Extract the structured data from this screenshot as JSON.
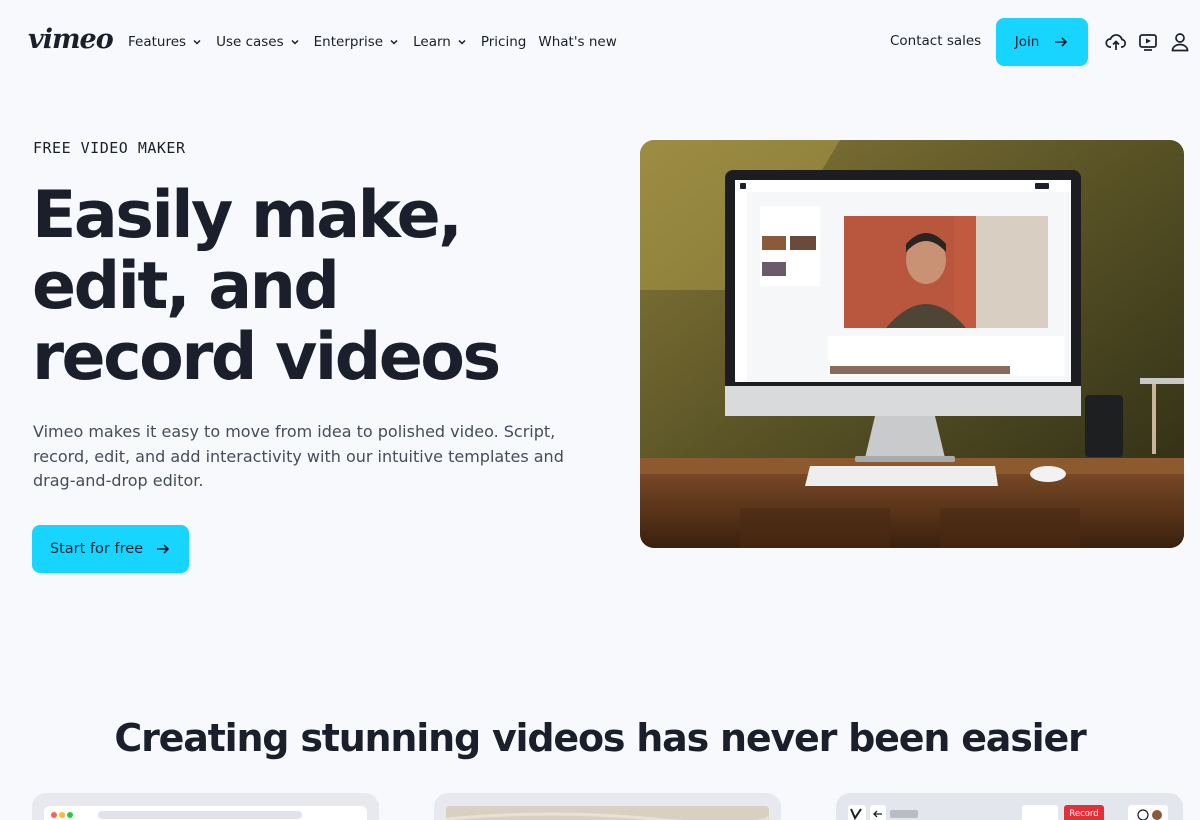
{
  "header": {
    "logo": "vimeo",
    "nav": [
      {
        "label": "Features",
        "dropdown": true
      },
      {
        "label": "Use cases",
        "dropdown": true
      },
      {
        "label": "Enterprise",
        "dropdown": true
      },
      {
        "label": "Learn",
        "dropdown": true
      },
      {
        "label": "Pricing",
        "dropdown": false
      },
      {
        "label": "What's new",
        "dropdown": false
      }
    ],
    "contact_label": "Contact sales",
    "join_label": "Join",
    "icons": [
      "upload-icon",
      "watch-later-icon",
      "user-icon"
    ]
  },
  "hero": {
    "eyebrow": "FREE VIDEO MAKER",
    "title_lines": [
      "Easily make,",
      "edit, and",
      "record videos"
    ],
    "lead": "Vimeo makes it easy to move from idea to polished video. Script, record, edit, and add interactivity with our intuitive templates and drag-and-drop editor.",
    "cta_label": "Start for free"
  },
  "section": {
    "title": "Creating stunning videos has never been easier"
  },
  "cards": {
    "card3_record_label": "Record"
  },
  "colors": {
    "accent": "#17d5ff",
    "text": "#1a1f2b",
    "background": "#f8f9fc",
    "record": "#e0313b"
  }
}
